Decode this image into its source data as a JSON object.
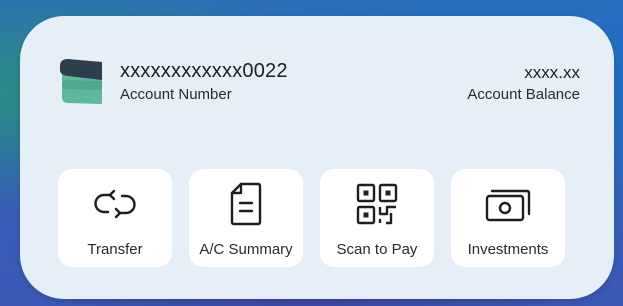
{
  "account": {
    "number": "xxxxxxxxxxxx0022",
    "number_label": "Account Number",
    "balance": "xxxx.xx",
    "balance_label": "Account Balance"
  },
  "actions": [
    {
      "label": "Transfer",
      "icon": "transfer-arrows-icon"
    },
    {
      "label": "A/C Summary",
      "icon": "document-icon"
    },
    {
      "label": "Scan to Pay",
      "icon": "qr-code-icon"
    },
    {
      "label": "Investments",
      "icon": "banknotes-icon"
    }
  ],
  "colors": {
    "widget_bg": "#e6eef7",
    "tile_bg": "#ffffff",
    "card_dark": "#2f3e4c",
    "card_teal": "#5fb89e"
  }
}
